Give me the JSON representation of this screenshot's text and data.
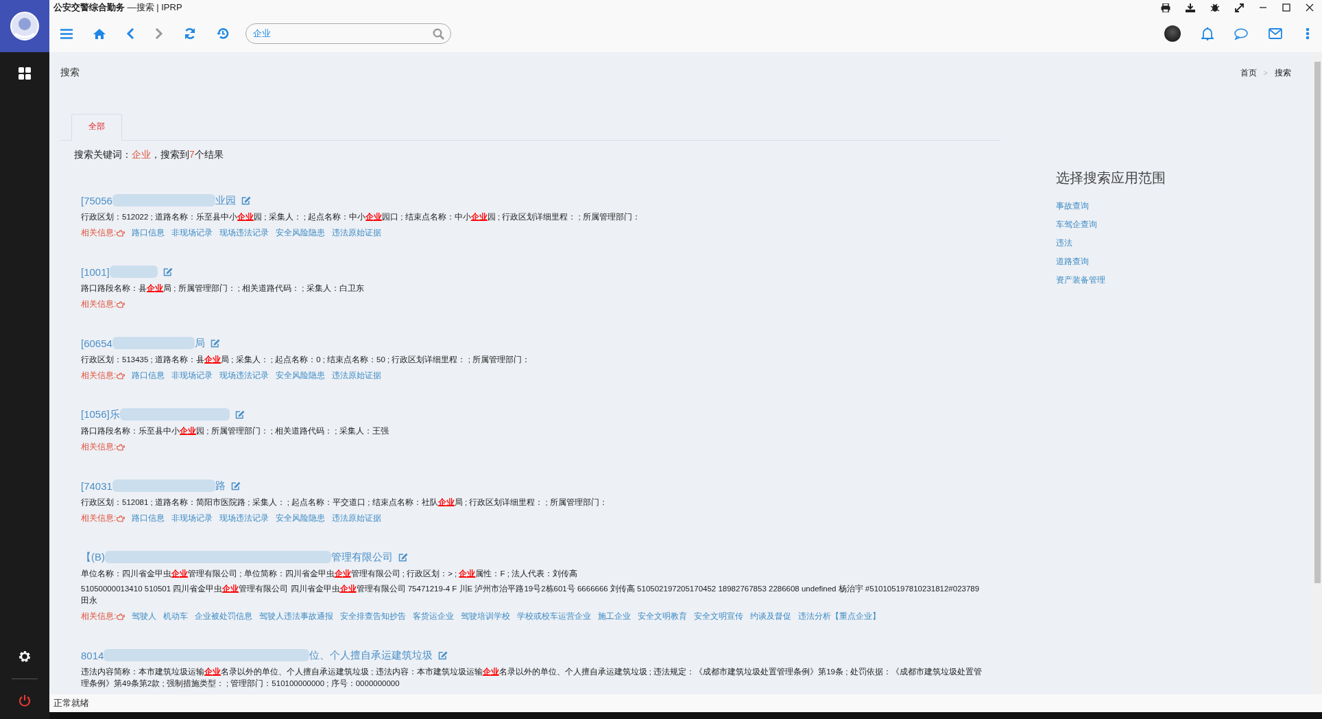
{
  "window": {
    "app_name": "公安交警综合勤务",
    "title_rest": "—搜索 | IPRP"
  },
  "toolbar": {
    "search": {
      "value": "企业"
    }
  },
  "page": {
    "title": "搜索",
    "breadcrumb": [
      {
        "label": "首页"
      },
      {
        "label": "搜索"
      }
    ],
    "breadcrumb_separator": ">"
  },
  "tabs": [
    {
      "label": "全部",
      "selected": true
    }
  ],
  "summary": {
    "prefix": "搜索关键词：",
    "keyword": "企业",
    "middle": "，搜索到",
    "count": "7",
    "suffix": "个结果"
  },
  "results": [
    {
      "title_head": "[75056",
      "title_tail": "业园",
      "details": [
        "行政区划：512022 ; 道路名称：乐至县中小**企业**园 ; 采集人： ; 起点名称：中小**企业**园口 ; 结束点名称：中小**企业**园 ; 行政区划详细里程： ; 所属管理部门："
      ],
      "related_label": "相关信息:",
      "links": [
        "路口信息",
        "非现场记录",
        "现场违法记录",
        "安全风险隐患",
        "违法原始证据"
      ]
    },
    {
      "title_head": "[1001]",
      "details": [
        "路口路段名称：县**企业**局 ; 所属管理部门： ; 相关道路代码： ; 采集人：白卫东"
      ],
      "related_label": "相关信息:"
    },
    {
      "title_head": "[60654",
      "title_tail": "局",
      "details": [
        "行政区划：513435 ; 道路名称：县**企业**局 ; 采集人： ; 起点名称：0 ; 结束点名称：50 ; 行政区划详细里程： ; 所属管理部门："
      ],
      "related_label": "相关信息:",
      "links": [
        "路口信息",
        "非现场记录",
        "现场违法记录",
        "安全风险隐患",
        "违法原始证据"
      ]
    },
    {
      "title_head": "[1056]乐",
      "details": [
        "路口路段名称：乐至县中小**企业**园 ; 所属管理部门： ; 相关道路代码： ; 采集人：王强"
      ],
      "related_label": "相关信息:"
    },
    {
      "title_head": "[74031",
      "title_tail": "路",
      "details": [
        "行政区划：512081 ; 道路名称：简阳市医院路 ; 采集人： ; 起点名称：平交道口 ; 结束点名称：社队**企业**局 ; 行政区划详细里程： ; 所属管理部门："
      ],
      "related_label": "相关信息:",
      "links": [
        "路口信息",
        "非现场记录",
        "现场违法记录",
        "安全风险隐患",
        "违法原始证据"
      ]
    },
    {
      "title_head": "【(B)",
      "title_tail": "管理有限公司",
      "details": [
        "单位名称：四川省金甲虫**企业**管理有限公司 ; 单位简称：四川省金甲虫**企业**管理有限公司 ; 行政区划：> ; **企业**属性：F ; 法人代表：刘传高",
        "51050000013410 510501 四川省金甲虫**企业**管理有限公司 四川省金甲虫**企业**管理有限公司 75471219-4 F 川E 泸州市治平路19号2栋601号 6666666 刘传高 510502197205170452 18982767853 2286608 undefined 杨治宇 #510105197810231812#023789 田永"
      ],
      "related_label": "相关信息:",
      "links": [
        "驾驶人",
        "机动车",
        "企业被处罚信息",
        "驾驶人违法事故通报",
        "安全排查告知抄告",
        "客货运企业",
        "驾驶培训学校",
        "学校或校车运营企业",
        "施工企业",
        "安全文明教育",
        "安全文明宣传",
        "约谈及督促",
        "违法分析【重点企业】"
      ]
    },
    {
      "title_head": "8014",
      "title_tail": "位、个人擅自承运建筑垃圾",
      "details": [
        "违法内容简称：本市建筑垃圾运输**企业**名录以外的单位、个人擅自承运建筑垃圾 ; 违法内容：本市建筑垃圾运输**企业**名录以外的单位、个人擅自承运建筑垃圾 ; 违法规定：《成都市建筑垃圾处置管理条例》第19条 ; 处罚依据：《成都市建筑垃圾处置管理条例》第49条第2款 ; 强制措施类型： ; 管理部门：510100000000 ; 序号：0000000000"
      ]
    }
  ],
  "scope_panel": {
    "title": "选择搜索应用范围",
    "items": [
      "事故查询",
      "车驾企查询",
      "违法",
      "道路查询",
      "资产装备管理"
    ]
  },
  "status_bar": {
    "text": "正常就绪"
  }
}
